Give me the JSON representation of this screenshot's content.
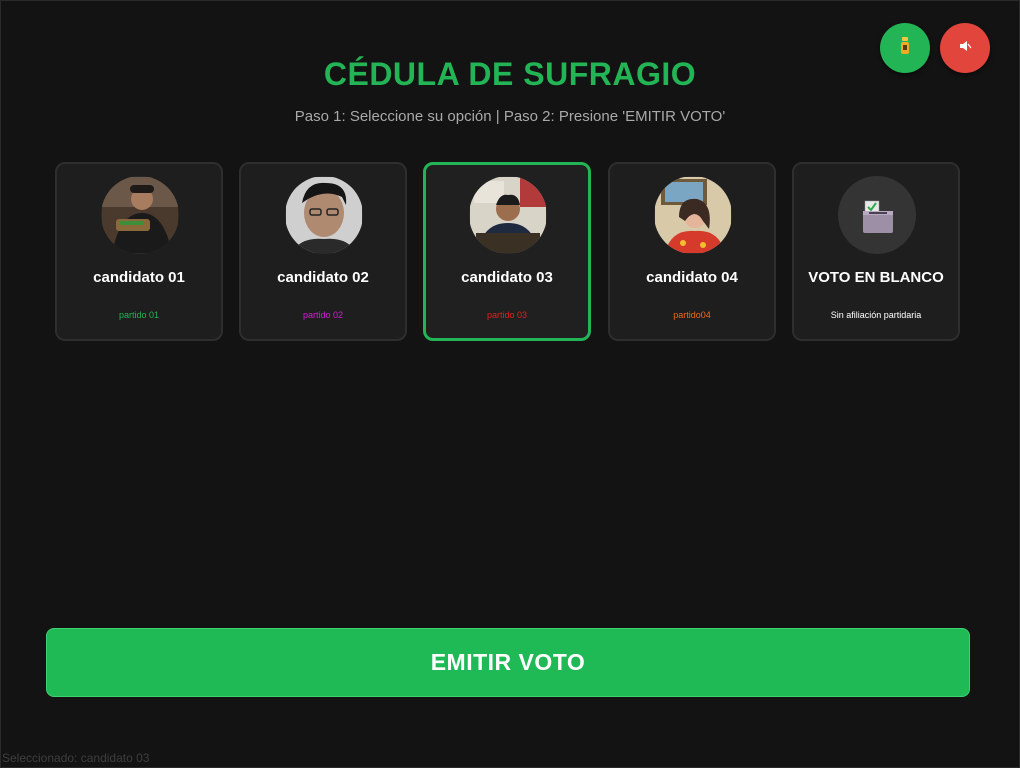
{
  "header": {
    "title": "CÉDULA DE SUFRAGIO",
    "subtitle": "Paso 1: Seleccione su opción | Paso 2: Presione 'EMITIR VOTO'"
  },
  "top_controls": {
    "accessibility_icon": "accessibility-icon",
    "mute_icon": "mute-icon",
    "accessibility_color": "#22b455",
    "mute_color": "#e2453c"
  },
  "candidates": [
    {
      "name": "candidato 01",
      "party": "partido 01",
      "party_color": "#22b455",
      "selected": false
    },
    {
      "name": "candidato 02",
      "party": "partido 02",
      "party_color": "#d21ed8",
      "selected": false
    },
    {
      "name": "candidato 03",
      "party": "partido 03",
      "party_color": "#e02020",
      "selected": true
    },
    {
      "name": "candidato 04",
      "party": "partido04",
      "party_color": "#f06a1a",
      "selected": false
    },
    {
      "name": "VOTO EN BLANCO",
      "party": "Sin afiliación partidaria",
      "party_color": "#ffffff",
      "selected": false,
      "icon": "ballot-box-icon"
    }
  ],
  "actions": {
    "emit_label": "EMITIR VOTO"
  },
  "status": {
    "text": "Seleccionado: candidato 03"
  },
  "colors": {
    "accent": "#22b455",
    "background": "#131313",
    "card": "#1e1e1e"
  }
}
